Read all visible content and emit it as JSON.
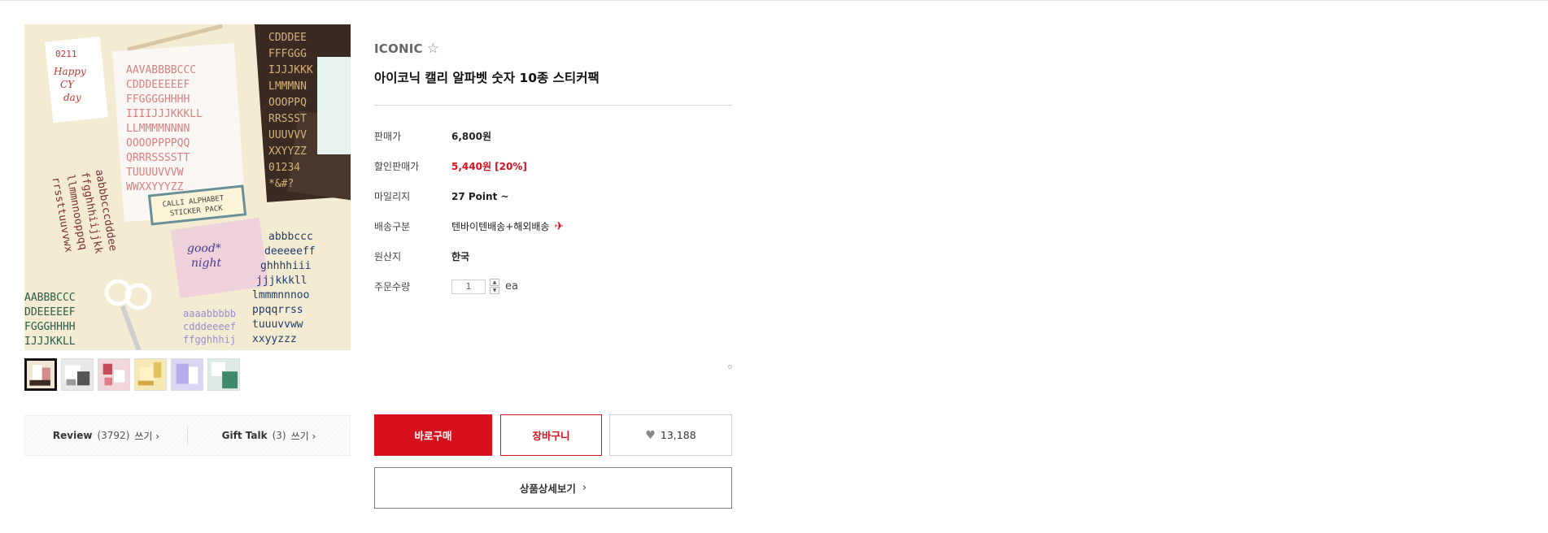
{
  "product": {
    "brand": "ICONIC",
    "title": "아이코닉 캘리 알파벳 숫자 10종 스티커팩",
    "image_texts": {
      "note_date": "0211",
      "note_line1": "Happy",
      "note_line2": "CY",
      "note_line3": "day",
      "pack_label_line1": "CALLI ALPHABET",
      "pack_label_line2": "STICKER PACK",
      "card_line1": "good*",
      "card_line2": "night"
    }
  },
  "details": {
    "rows": [
      {
        "label": "판매가",
        "value": "6,800원"
      },
      {
        "label": "할인판매가",
        "value": "5,440원 [20%]"
      },
      {
        "label": "마일리지",
        "value": "27 Point ~"
      },
      {
        "label": "배송구분",
        "value": "텐바이텐배송+해외배송"
      },
      {
        "label": "원산지",
        "value": "한국"
      },
      {
        "label": "주문수량",
        "value": "1",
        "unit": "ea"
      }
    ]
  },
  "reviews": {
    "review_label": "Review",
    "review_count": "(3792)",
    "gift_label": "Gift Talk",
    "gift_count": "(3)",
    "write_label": "쓰기 ›"
  },
  "actions": {
    "buy": "바로구매",
    "cart": "장바구니",
    "like_count": "13,188",
    "detail": "상품상세보기",
    "detail_chevron": "›"
  },
  "icons": {
    "star": "star-outline-icon",
    "plane": "airplane-icon",
    "heart": "heart-icon"
  },
  "colors": {
    "accent": "#d6101c"
  }
}
